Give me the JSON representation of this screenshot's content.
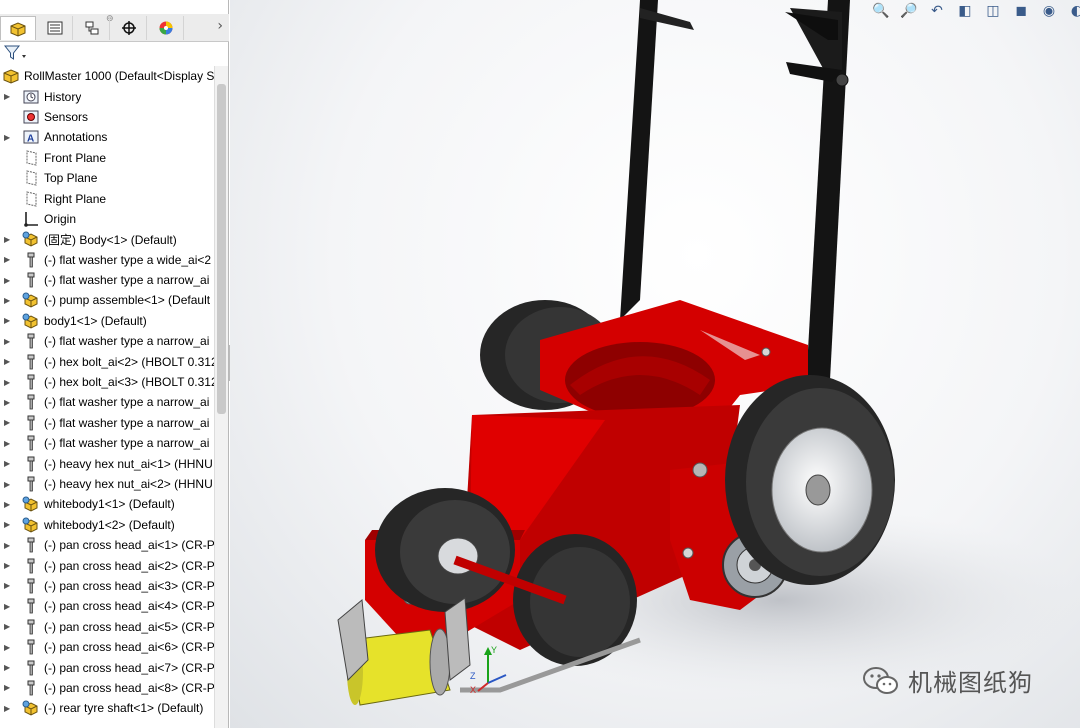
{
  "panel": {
    "tabs": [
      {
        "name": "feature-manager-tab",
        "icon": "assembly-icon"
      },
      {
        "name": "property-manager-tab",
        "icon": "property-list-icon"
      },
      {
        "name": "configuration-manager-tab",
        "icon": "configuration-icon"
      },
      {
        "name": "dimxpert-tab",
        "icon": "crosshair-icon"
      },
      {
        "name": "display-manager-tab",
        "icon": "color-wheel-icon"
      }
    ],
    "more": "›"
  },
  "tree": {
    "items": [
      {
        "label": "RollMaster 1000  (Default<Display St",
        "icon": "assembly-icon",
        "arrow": false,
        "root": true
      },
      {
        "label": "History",
        "icon": "history-icon",
        "arrow": true
      },
      {
        "label": "Sensors",
        "icon": "sensor-icon",
        "arrow": false
      },
      {
        "label": "Annotations",
        "icon": "annotation-icon",
        "arrow": true
      },
      {
        "label": "Front Plane",
        "icon": "plane-icon",
        "arrow": false
      },
      {
        "label": "Top Plane",
        "icon": "plane-icon",
        "arrow": false
      },
      {
        "label": "Right Plane",
        "icon": "plane-icon",
        "arrow": false
      },
      {
        "label": "Origin",
        "icon": "origin-icon",
        "arrow": false
      },
      {
        "label": "(固定) Body<1> (Default)",
        "icon": "subassembly-icon",
        "arrow": true
      },
      {
        "label": "(-) flat washer type a wide_ai<2",
        "icon": "part-icon",
        "arrow": true
      },
      {
        "label": "(-) flat washer type a narrow_ai",
        "icon": "part-icon",
        "arrow": true
      },
      {
        "label": "(-) pump assemble<1> (Default",
        "icon": "subassembly-icon",
        "arrow": true
      },
      {
        "label": "body1<1> (Default)",
        "icon": "subassembly-icon",
        "arrow": true
      },
      {
        "label": "(-) flat washer type a narrow_ai",
        "icon": "part-icon",
        "arrow": true
      },
      {
        "label": "(-) hex bolt_ai<2> (HBOLT 0.312",
        "icon": "part-icon",
        "arrow": true
      },
      {
        "label": "(-) hex bolt_ai<3> (HBOLT 0.312",
        "icon": "part-icon",
        "arrow": true
      },
      {
        "label": "(-) flat washer type a narrow_ai",
        "icon": "part-icon",
        "arrow": true
      },
      {
        "label": "(-) flat washer type a narrow_ai",
        "icon": "part-icon",
        "arrow": true
      },
      {
        "label": "(-) flat washer type a narrow_ai",
        "icon": "part-icon",
        "arrow": true
      },
      {
        "label": "(-) heavy hex nut_ai<1> (HHNU",
        "icon": "part-icon",
        "arrow": true
      },
      {
        "label": "(-) heavy hex nut_ai<2> (HHNU",
        "icon": "part-icon",
        "arrow": true
      },
      {
        "label": "whitebody1<1> (Default)",
        "icon": "subassembly-icon",
        "arrow": true
      },
      {
        "label": "whitebody1<2> (Default)",
        "icon": "subassembly-icon",
        "arrow": true
      },
      {
        "label": "(-) pan cross head_ai<1> (CR-P",
        "icon": "part-icon",
        "arrow": true
      },
      {
        "label": "(-) pan cross head_ai<2> (CR-P",
        "icon": "part-icon",
        "arrow": true
      },
      {
        "label": "(-) pan cross head_ai<3> (CR-P",
        "icon": "part-icon",
        "arrow": true
      },
      {
        "label": "(-) pan cross head_ai<4> (CR-P",
        "icon": "part-icon",
        "arrow": true
      },
      {
        "label": "(-) pan cross head_ai<5> (CR-P",
        "icon": "part-icon",
        "arrow": true
      },
      {
        "label": "(-) pan cross head_ai<6> (CR-P",
        "icon": "part-icon",
        "arrow": true
      },
      {
        "label": "(-) pan cross head_ai<7> (CR-P",
        "icon": "part-icon",
        "arrow": true
      },
      {
        "label": "(-) pan cross head_ai<8> (CR-P",
        "icon": "part-icon",
        "arrow": true
      },
      {
        "label": "(-) rear tyre shaft<1> (Default)",
        "icon": "subassembly-icon",
        "arrow": true
      }
    ]
  },
  "viewport": {
    "heads_up_icons": [
      "zoom-to-fit-icon",
      "zoom-area-icon",
      "previous-view-icon",
      "section-view-icon",
      "view-orientation-icon",
      "display-style-icon",
      "hide-show-icon",
      "edit-appearance-icon",
      "apply-scene-icon",
      "view-settings-icon"
    ],
    "triad_labels": {
      "x": "X",
      "y": "Y",
      "z": "Z"
    },
    "colors": {
      "frame": "#d40000",
      "frame_dark": "#8e0000",
      "handle": "#141414",
      "tyre": "#2a2a2a",
      "roller": "#e6e22a"
    }
  },
  "watermark": {
    "text": "机械图纸狗"
  }
}
